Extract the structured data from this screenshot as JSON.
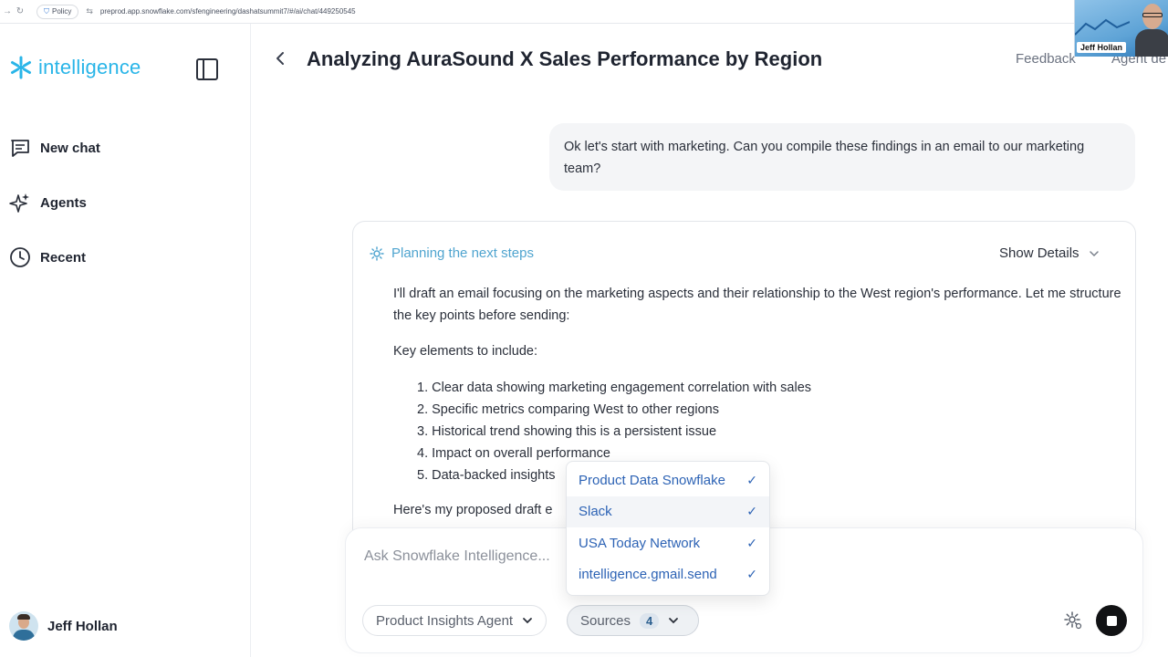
{
  "browser": {
    "policy_label": "Policy",
    "url": "preprod.app.snowflake.com/sfengineering/dashatsummit7/#/ai/chat/449250545"
  },
  "brand": {
    "name": "intelligence",
    "color": "#29b5e8",
    "icon": "snowflake-icon"
  },
  "sidebar": {
    "items": [
      {
        "label": "New chat",
        "icon": "new-chat-icon"
      },
      {
        "label": "Agents",
        "icon": "sparkle-icon"
      },
      {
        "label": "Recent",
        "icon": "clock-icon"
      }
    ],
    "user": {
      "name": "Jeff Hollan"
    }
  },
  "header": {
    "title": "Analyzing AuraSound X Sales Performance by Region",
    "feedback": "Feedback",
    "agent_link": "Agent de"
  },
  "video": {
    "name": "Jeff Hollan"
  },
  "conversation": {
    "user_message": "Ok let's start with marketing. Can you compile these findings in an email to our marketing team?",
    "response": {
      "status": "Planning the next steps",
      "show_details": "Show Details",
      "intro": "I'll draft an email focusing on the marketing aspects and their relationship to the West region's performance. Let me structure the key points before sending:",
      "key_elements_label": "Key elements to include:",
      "list": [
        "1. Clear data showing marketing engagement correlation with sales",
        "2. Specific metrics comparing West to other regions",
        "3. Historical trend showing this is a persistent issue",
        "4. Impact on overall performance",
        "5. Data-backed insights"
      ],
      "draft_label": "Here's my proposed draft e"
    }
  },
  "composer": {
    "placeholder": "Ask Snowflake Intelligence...",
    "agent": "Product Insights Agent",
    "sources_label": "Sources",
    "sources_count": "4"
  },
  "sources_dropdown": {
    "items": [
      {
        "label": "Product Data Snowflake",
        "checked": true
      },
      {
        "label": "Slack",
        "checked": true
      },
      {
        "label": "USA Today Network",
        "checked": true
      },
      {
        "label": "intelligence.gmail.send",
        "checked": true
      }
    ]
  },
  "colors": {
    "accent": "#29b5e8",
    "link": "#2d63b5",
    "status": "#4fa4cf"
  }
}
